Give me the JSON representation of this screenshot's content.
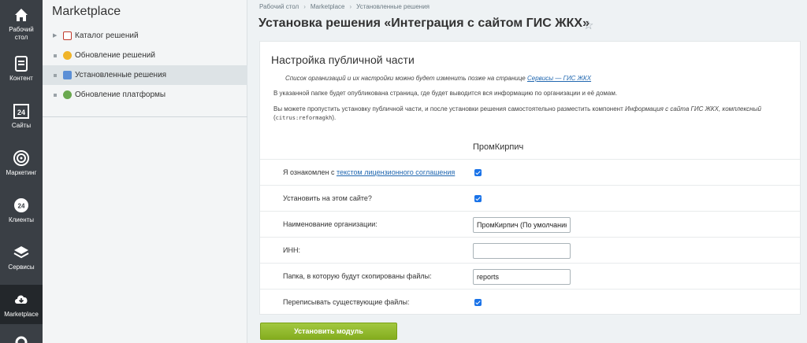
{
  "iconbar": {
    "items": [
      {
        "label1": "Рабочий",
        "label2": "стол",
        "icon": "home-icon"
      },
      {
        "label1": "Контент",
        "label2": "",
        "icon": "document-icon"
      },
      {
        "label1": "Сайты",
        "label2": "",
        "icon": "calendar-24-icon"
      },
      {
        "label1": "Маркетинг",
        "label2": "",
        "icon": "target-icon"
      },
      {
        "label1": "Клиенты",
        "label2": "",
        "icon": "clients-24-icon"
      },
      {
        "label1": "Сервисы",
        "label2": "",
        "icon": "layers-icon"
      },
      {
        "label1": "Marketplace",
        "label2": "",
        "icon": "cloud-download-icon",
        "active": true
      }
    ]
  },
  "menu": {
    "title": "Marketplace",
    "items": [
      {
        "label": "Каталог решений",
        "marker": "arrow"
      },
      {
        "label": "Обновление решений",
        "marker": "dot"
      },
      {
        "label": "Установленные решения",
        "marker": "dot",
        "active": true
      },
      {
        "label": "Обновление платформы",
        "marker": "dot"
      }
    ]
  },
  "breadcrumbs": [
    "Рабочий стол",
    "Marketplace",
    "Установленные решения"
  ],
  "page_title": "Установка решения «Интеграция с сайтом ГИС ЖКХ»",
  "panel": {
    "heading": "Настройка публичной части",
    "note1_text": "Список организаций и их настройки можно будет изменить позже на странице ",
    "note1_link": "Сервисы — ГИС ЖКХ",
    "note2": "В указанной папке будет опубликована страница, где будет выводится вся информацию по организации и её домам.",
    "note3_a": "Вы можете пропустить установку публичной части, и после установки решения самостоятельно разместить компонент ",
    "note3_b": "Информация с сайта ГИС ЖКХ, комплексный",
    "note3_c": " (",
    "note3_code": "citrus:reformagkh",
    "note3_d": ").",
    "org_header": "ПромКирпич",
    "license_prefix": "Я ознакомлен с ",
    "license_link": "текстом лицензионного соглашения",
    "install_label": "Установить на этом сайте?",
    "org_name_label": "Наименование организации:",
    "org_name_value": "ПромКирпич (По умолчанию)",
    "inn_label": "ИНН:",
    "inn_value": "",
    "folder_label": "Папка, в которую будут скопированы файлы:",
    "folder_value": "reports",
    "overwrite_label": "Переписывать существующие файлы:",
    "license_checked": true,
    "install_checked": true,
    "overwrite_checked": true
  },
  "install_button": "Установить модуль",
  "colors": {
    "accent_green": "#8ab32a",
    "link": "#2067b0",
    "checkbox": "#1a73e8",
    "sidebar_dark": "#3a3f45"
  }
}
